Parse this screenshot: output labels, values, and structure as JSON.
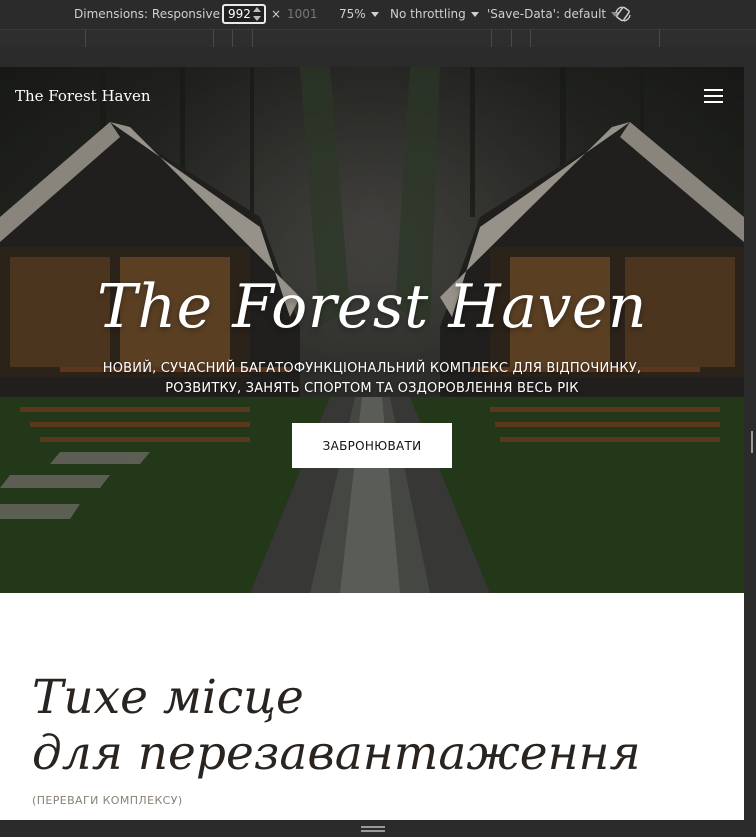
{
  "devtools": {
    "dimensions_label": "Dimensions: Responsive",
    "width_value": "992",
    "times": "×",
    "height_value": "1001",
    "zoom": "75%",
    "throttling": "No throttling",
    "save_data": "'Save-Data': default"
  },
  "site": {
    "brand": "The Forest Haven",
    "hero": {
      "title": "The Forest Haven",
      "subtitle": "НОВИЙ, СУЧАСНИЙ БАГАТОФУНКЦІОНАЛЬНИЙ КОМПЛЕКС ДЛЯ ВІДПОЧИНКУ, РОЗВИТКУ, ЗАНЯТЬ СПОРТОМ ТА ОЗДОРОВЛЕННЯ ВЕСЬ РІК",
      "button": "ЗАБРОНЮВАТИ"
    },
    "about": {
      "title_line1": "Тихе місце",
      "title_line2": "для перезавантаження",
      "subtitle": "(ПЕРЕВАГИ КОМПЛЕКСУ)"
    }
  },
  "colors": {
    "devtools_bg": "#2b2b2b",
    "text_dark": "#2a2420",
    "muted": "#8a8075"
  }
}
